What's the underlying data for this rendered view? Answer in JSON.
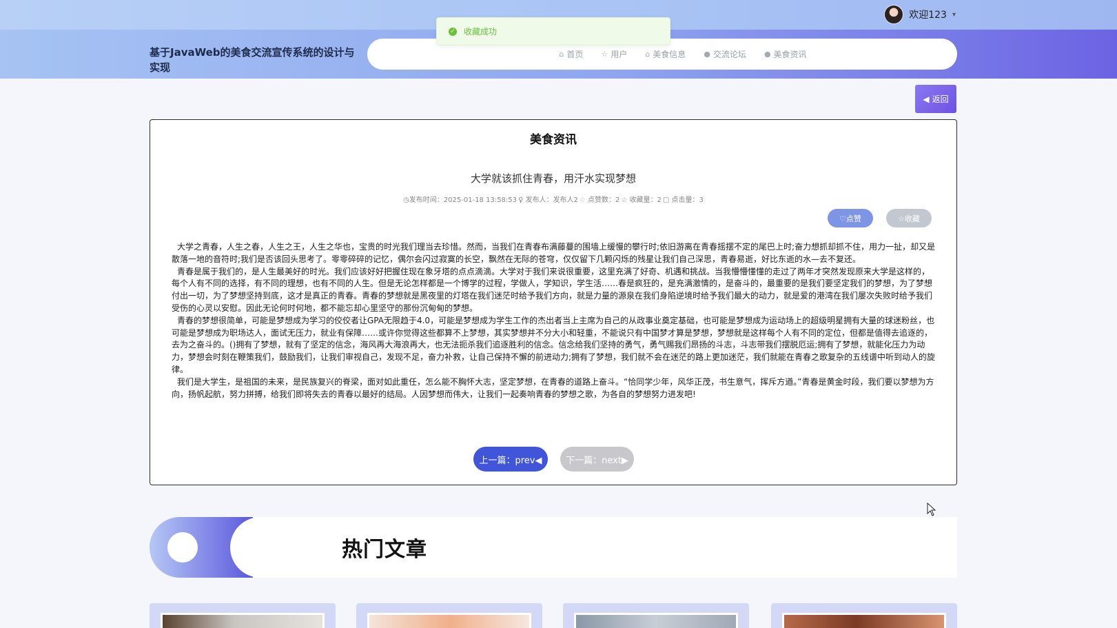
{
  "user": {
    "greeting": "欢迎123",
    "caret": "▾"
  },
  "site": {
    "title": "基于JavaWeb的美食交流宣传系统的设计与实现"
  },
  "nav": {
    "items": [
      {
        "label": "首页",
        "icon": "⌂"
      },
      {
        "label": "用户",
        "icon": "☆"
      },
      {
        "label": "美食信息",
        "icon": "⌂"
      },
      {
        "label": "交流论坛",
        "icon": "●"
      },
      {
        "label": "美食资讯",
        "icon": "●"
      }
    ]
  },
  "toast": {
    "message": "收藏成功",
    "icon": "✓"
  },
  "back_button": {
    "label": "返回",
    "icon": "◀"
  },
  "article": {
    "section_heading": "美食资讯",
    "title": "大学就该抓住青春，用汗水实现梦想",
    "meta": {
      "publish_time": "◷发布时间：2025-01-18 13:58:53",
      "publisher": "♀ 发布人：发布人2",
      "likes": "♢ 点赞数：2",
      "favorites": "☆ 收藏量：2",
      "clicks": "▢ 点击量：3"
    },
    "like_label": "♡点赞",
    "favorite_label": "☆收藏",
    "paragraphs": [
      "大学之青春，人生之春，人生之王，人生之华也，宝贵的时光我们理当去珍惜。然而，当我们在青春布满藤蔓的围墙上缓慢的攀行时;依旧游离在青春摇摆不定的尾巴上时;奋力想抓却抓不住，用力一扯，却又是散落一地的音符时;我们是否该回头思考了。零零碎碎的记忆，偶尔会闪过寂寞的长空，飘然在无际的苍穹，仅仅留下几颗闪烁的残星让我们自己深思，青春易逝，好比东逝的水—去不复还。",
      "青春是属于我们的，是人生最美好的时光。我们应该好好把握住现在象牙塔的点点滴滴。大学对于我们来说很重要，这里充满了好奇、机遇和挑战。当我懵懵懂懂的走过了两年才突然发现原来大学是这样的，每个人有不同的选择，有不同的理想，也有不同的人生。但是无论怎样都是一个博学的过程，学做人，学知识，学生活……春是疯狂的，是充满激情的，是奋斗的，最重要的是我们要坚定我们的梦想，为了梦想付出一切，为了梦想坚持到底，这才是真正的青春。青春的梦想就是黑夜里的灯塔在我们迷茫时给予我们方向，就是力量的源泉在我们身陷逆境时给予我们最大的动力，就是爱的港湾在我们屡次失败时给予我们受伤的心灵以安慰。因此无论何时何地，都不能忘却心里坚守的那份沉甸甸的梦想。",
      "青春的梦想很简单，可能是梦想成为学习的佼佼者让GPA无限趋于4.0，可能是梦想成为学生工作的杰出者当上主席为自己的从政事业奠定基础，也可能是梦想成为运动场上的超级明星拥有大量的球迷粉丝，也可能是梦想成为职场达人，面试无压力，就业有保障……或许你觉得这些都算不上梦想，其实梦想并不分大小和轻重，不能说只有中国梦才算是梦想，梦想就是这样每个人有不同的定位，但都是值得去追逐的，去为之奋斗的。()拥有了梦想，就有了坚定的信念，海风再大海浪再大，也无法扼杀我们追逐胜利的信念。信念给我们坚持的勇气，勇气赐我们昂扬的斗志，斗志带我们摆脱厄运;拥有了梦想，就能化压力为动力，梦想会时刻在鞭策我们，鼓励我们，让我们审视自己，发现不足，奋力补救，让自己保持不懈的前进动力;拥有了梦想，我们就不会在迷茫的路上更加迷茫，我们就能在青春之歌复杂的五线谱中听到动人的旋律。",
      "我们是大学生，是祖国的未来，是民族复兴的脊梁，面对如此重任，怎么能不胸怀大志，坚定梦想，在青春的道路上奋斗。“恰同学少年，风华正茂，书生意气，挥斥方遒。”青春是黄金时段，我们要以梦想为方向，扬帆起航，努力拼搏，给我们即将失去的青春以最好的结局。人因梦想而伟大，让我们一起奏响青春的梦想之歌，为各自的梦想努力进发吧!"
    ],
    "prev_label": "上一篇：prev◀",
    "next_label": "下一篇：next▶"
  },
  "hot": {
    "title": "热门文章"
  }
}
